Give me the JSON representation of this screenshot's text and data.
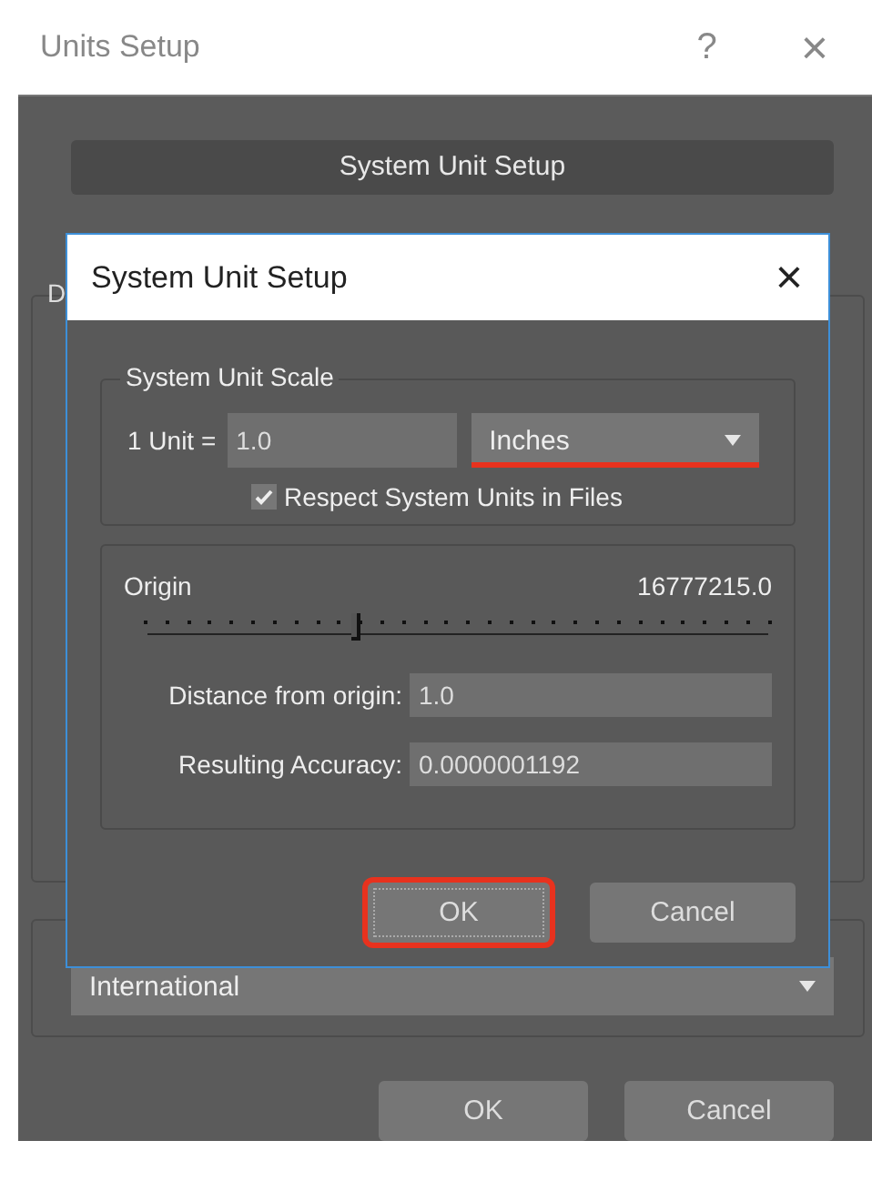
{
  "window": {
    "title": "Units Setup",
    "help": "?",
    "close": "×"
  },
  "system_unit_setup_button": "System Unit Setup",
  "hidden_group": {
    "label": "D"
  },
  "lighting_units": {
    "value": "International"
  },
  "buttons": [
    {
      "label": "OK"
    },
    {
      "label": "Cancel"
    }
  ],
  "dialog": {
    "title": "System Unit Setup",
    "close": "×",
    "scale_group": {
      "label": "System Unit Scale",
      "unit_label": "1 Unit =",
      "unit_value": "1.0",
      "unit_type": "Inches",
      "unit_type_annotated": true,
      "respect_label": "Respect System Units in Files",
      "respect_checked": true
    },
    "origin": {
      "label": "Origin",
      "value": "16777215.0",
      "level": 0.33,
      "fields": [
        {
          "label": "Distance from origin:",
          "value": "1.0"
        },
        {
          "label": "Resulting Accuracy:",
          "value": "0.0000001192"
        }
      ]
    },
    "buttons": [
      {
        "label": "OK",
        "annotated": true
      },
      {
        "label": "Cancel",
        "annotated": false
      }
    ]
  }
}
